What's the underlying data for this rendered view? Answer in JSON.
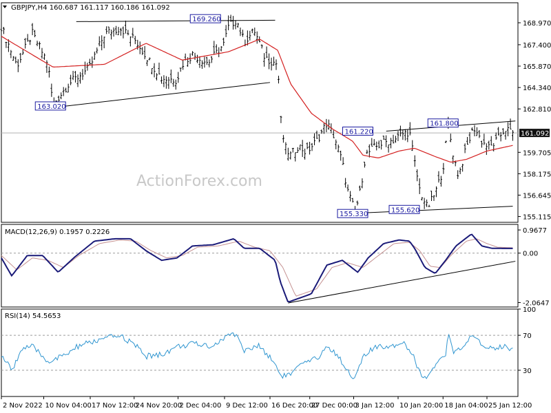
{
  "chart_data": [
    {
      "type": "candlestick",
      "symbol": "GBPJPY",
      "timeframe": "H4",
      "header": "GBPJPY,H4  160.687 161.117 160.186 161.092",
      "ohlc": {
        "open": 160.687,
        "high": 161.117,
        "low": 160.186,
        "close": 161.092
      },
      "last_price": "161.092",
      "ylim": [
        154.7,
        170.4
      ],
      "y_ticks": [
        "168.970",
        "167.400",
        "165.870",
        "164.340",
        "162.810",
        "161.092",
        "159.705",
        "158.175",
        "156.645",
        "155.115"
      ],
      "y_tick_values": [
        168.97,
        167.4,
        165.87,
        164.34,
        162.81,
        161.092,
        159.705,
        158.175,
        156.645,
        155.115
      ],
      "x_ticks": [
        "2 Nov 2022",
        "10 Nov 04:00",
        "17 Nov 12:00",
        "24 Nov 20:00",
        "2 Dec 04:00",
        "9 Dec 12:00",
        "16 Dec 20:00",
        "27 Dec 00:00",
        "3 Jan 12:00",
        "10 Jan 20:00",
        "18 Jan 04:00",
        "25 Jan 12:00"
      ],
      "annotations": [
        {
          "text": "163.020",
          "value": 163.02,
          "at": 0.095
        },
        {
          "text": "169.260",
          "value": 169.26,
          "at": 0.395
        },
        {
          "text": "161.220",
          "value": 161.22,
          "at": 0.69
        },
        {
          "text": "161.800",
          "value": 161.8,
          "at": 0.855
        },
        {
          "text": "155.330",
          "value": 155.33,
          "at": 0.68
        },
        {
          "text": "155.620",
          "value": 155.62,
          "at": 0.78
        }
      ],
      "trendlines": [
        {
          "from": [
            0.145,
            169.05
          ],
          "to": [
            0.53,
            169.15
          ]
        },
        {
          "from": [
            0.11,
            162.95
          ],
          "to": [
            0.52,
            164.7
          ]
        },
        {
          "from": [
            0.685,
            155.35
          ],
          "to": [
            0.99,
            155.85
          ]
        },
        {
          "from": [
            0.745,
            161.22
          ],
          "to": [
            0.995,
            161.95
          ]
        }
      ],
      "series": [
        {
          "role": "price",
          "points": [
            [
              0,
              168.7
            ],
            [
              0.03,
              165.9
            ],
            [
              0.06,
              168.2
            ],
            [
              0.09,
              166.1
            ],
            [
              0.1,
              163.1
            ],
            [
              0.13,
              164.6
            ],
            [
              0.17,
              165.7
            ],
            [
              0.2,
              168.2
            ],
            [
              0.23,
              168.6
            ],
            [
              0.26,
              167.7
            ],
            [
              0.28,
              166.6
            ],
            [
              0.31,
              165.0
            ],
            [
              0.34,
              164.9
            ],
            [
              0.35,
              166.0
            ],
            [
              0.37,
              166.7
            ],
            [
              0.4,
              166.1
            ],
            [
              0.43,
              167.4
            ],
            [
              0.44,
              168.7
            ],
            [
              0.455,
              169.2
            ],
            [
              0.47,
              167.6
            ],
            [
              0.49,
              168.4
            ],
            [
              0.51,
              166.5
            ],
            [
              0.535,
              166.0
            ],
            [
              0.542,
              161.5
            ],
            [
              0.55,
              160.0
            ],
            [
              0.56,
              159.5
            ],
            [
              0.575,
              160.2
            ],
            [
              0.59,
              159.7
            ],
            [
              0.61,
              160.5
            ],
            [
              0.63,
              161.8
            ],
            [
              0.645,
              160.8
            ],
            [
              0.66,
              159.0
            ],
            [
              0.67,
              157.0
            ],
            [
              0.685,
              155.4
            ],
            [
              0.695,
              157.0
            ],
            [
              0.705,
              159.5
            ],
            [
              0.72,
              160.0
            ],
            [
              0.74,
              160.4
            ],
            [
              0.76,
              160.6
            ],
            [
              0.775,
              161.0
            ],
            [
              0.79,
              161.2
            ],
            [
              0.8,
              159.0
            ],
            [
              0.81,
              157.0
            ],
            [
              0.825,
              155.7
            ],
            [
              0.84,
              156.8
            ],
            [
              0.855,
              158.5
            ],
            [
              0.865,
              161.7
            ],
            [
              0.875,
              159.5
            ],
            [
              0.885,
              158.0
            ],
            [
              0.9,
              160.0
            ],
            [
              0.915,
              161.5
            ],
            [
              0.93,
              160.5
            ],
            [
              0.945,
              160.0
            ],
            [
              0.96,
              160.6
            ],
            [
              0.975,
              161.4
            ],
            [
              0.99,
              161.09
            ]
          ]
        },
        {
          "role": "ma",
          "points": [
            [
              0,
              168.0
            ],
            [
              0.1,
              165.8
            ],
            [
              0.2,
              166.0
            ],
            [
              0.28,
              167.5
            ],
            [
              0.35,
              166.3
            ],
            [
              0.44,
              166.9
            ],
            [
              0.5,
              167.8
            ],
            [
              0.535,
              167.0
            ],
            [
              0.56,
              164.6
            ],
            [
              0.6,
              162.5
            ],
            [
              0.64,
              161.4
            ],
            [
              0.68,
              160.5
            ],
            [
              0.7,
              159.5
            ],
            [
              0.73,
              159.3
            ],
            [
              0.77,
              159.8
            ],
            [
              0.8,
              160.0
            ],
            [
              0.84,
              159.4
            ],
            [
              0.87,
              159.0
            ],
            [
              0.9,
              159.2
            ],
            [
              0.94,
              159.8
            ],
            [
              0.99,
              160.2
            ]
          ]
        }
      ]
    },
    {
      "type": "line",
      "label": "MACD(12,26,9) 0.1957 0.2226",
      "ylim": [
        -2.25,
        1.2
      ],
      "y_ticks": [
        "0.9677",
        "0.00",
        "-2.0647"
      ],
      "y_tick_values": [
        0.9677,
        0,
        -2.0647
      ],
      "trendlines": [
        {
          "from": [
            0.555,
            -2.08
          ],
          "to": [
            0.995,
            -0.34
          ]
        }
      ],
      "series": [
        {
          "role": "macd",
          "points": [
            [
              0,
              -0.2
            ],
            [
              0.02,
              -0.95
            ],
            [
              0.05,
              -0.1
            ],
            [
              0.08,
              -0.1
            ],
            [
              0.11,
              -0.8
            ],
            [
              0.14,
              -0.2
            ],
            [
              0.18,
              0.5
            ],
            [
              0.22,
              0.6
            ],
            [
              0.25,
              0.6
            ],
            [
              0.28,
              0.1
            ],
            [
              0.31,
              -0.3
            ],
            [
              0.34,
              -0.2
            ],
            [
              0.37,
              0.3
            ],
            [
              0.41,
              0.35
            ],
            [
              0.45,
              0.6
            ],
            [
              0.47,
              0.2
            ],
            [
              0.5,
              0.2
            ],
            [
              0.53,
              -0.3
            ],
            [
              0.54,
              -1.2
            ],
            [
              0.555,
              -2.05
            ],
            [
              0.6,
              -1.7
            ],
            [
              0.63,
              -0.5
            ],
            [
              0.66,
              -0.3
            ],
            [
              0.69,
              -0.8
            ],
            [
              0.71,
              -0.2
            ],
            [
              0.74,
              0.4
            ],
            [
              0.77,
              0.55
            ],
            [
              0.79,
              0.5
            ],
            [
              0.8,
              0.2
            ],
            [
              0.82,
              -0.6
            ],
            [
              0.84,
              -0.85
            ],
            [
              0.86,
              -0.3
            ],
            [
              0.88,
              0.3
            ],
            [
              0.91,
              0.8
            ],
            [
              0.93,
              0.3
            ],
            [
              0.95,
              0.2
            ],
            [
              0.99,
              0.1957
            ]
          ]
        },
        {
          "role": "signal",
          "points": [
            [
              0,
              -0.1
            ],
            [
              0.03,
              -0.7
            ],
            [
              0.06,
              -0.2
            ],
            [
              0.09,
              -0.3
            ],
            [
              0.12,
              -0.6
            ],
            [
              0.15,
              -0.1
            ],
            [
              0.19,
              0.4
            ],
            [
              0.23,
              0.55
            ],
            [
              0.26,
              0.5
            ],
            [
              0.29,
              0.1
            ],
            [
              0.32,
              -0.2
            ],
            [
              0.35,
              -0.1
            ],
            [
              0.38,
              0.25
            ],
            [
              0.42,
              0.3
            ],
            [
              0.46,
              0.5
            ],
            [
              0.49,
              0.25
            ],
            [
              0.52,
              0.1
            ],
            [
              0.545,
              -0.6
            ],
            [
              0.57,
              -1.8
            ],
            [
              0.61,
              -1.5
            ],
            [
              0.64,
              -0.6
            ],
            [
              0.67,
              -0.4
            ],
            [
              0.7,
              -0.6
            ],
            [
              0.73,
              -0.1
            ],
            [
              0.76,
              0.4
            ],
            [
              0.79,
              0.45
            ],
            [
              0.81,
              0.1
            ],
            [
              0.83,
              -0.55
            ],
            [
              0.85,
              -0.6
            ],
            [
              0.87,
              -0.1
            ],
            [
              0.9,
              0.5
            ],
            [
              0.92,
              0.6
            ],
            [
              0.94,
              0.4
            ],
            [
              0.96,
              0.25
            ],
            [
              0.99,
              0.2226
            ]
          ]
        }
      ]
    },
    {
      "type": "line",
      "label": "RSI(14) 54.5653",
      "ylim": [
        0,
        100
      ],
      "y_ticks": [
        "100",
        "70",
        "30",
        "0"
      ],
      "y_tick_values": [
        100,
        70,
        30,
        0
      ],
      "series": [
        {
          "role": "rsi",
          "points": [
            [
              0,
              47
            ],
            [
              0.02,
              30
            ],
            [
              0.04,
              55
            ],
            [
              0.06,
              57
            ],
            [
              0.09,
              40
            ],
            [
              0.12,
              46
            ],
            [
              0.15,
              58
            ],
            [
              0.2,
              66
            ],
            [
              0.23,
              70
            ],
            [
              0.26,
              58
            ],
            [
              0.28,
              46
            ],
            [
              0.31,
              48
            ],
            [
              0.34,
              57
            ],
            [
              0.37,
              60
            ],
            [
              0.41,
              58
            ],
            [
              0.44,
              70
            ],
            [
              0.455,
              72
            ],
            [
              0.47,
              52
            ],
            [
              0.5,
              58
            ],
            [
              0.53,
              38
            ],
            [
              0.54,
              24
            ],
            [
              0.56,
              25
            ],
            [
              0.58,
              36
            ],
            [
              0.61,
              43
            ],
            [
              0.63,
              57
            ],
            [
              0.65,
              48
            ],
            [
              0.67,
              30
            ],
            [
              0.685,
              20
            ],
            [
              0.7,
              45
            ],
            [
              0.72,
              55
            ],
            [
              0.75,
              58
            ],
            [
              0.78,
              62
            ],
            [
              0.8,
              44
            ],
            [
              0.81,
              26
            ],
            [
              0.825,
              22
            ],
            [
              0.84,
              36
            ],
            [
              0.86,
              46
            ],
            [
              0.865,
              71
            ],
            [
              0.875,
              52
            ],
            [
              0.89,
              53
            ],
            [
              0.91,
              68
            ],
            [
              0.93,
              60
            ],
            [
              0.95,
              55
            ],
            [
              0.97,
              58
            ],
            [
              0.99,
              54.5653
            ]
          ]
        }
      ]
    }
  ],
  "watermark": "ActionForex.com",
  "colors": {
    "price": "#000000",
    "ma": "#d42020",
    "macd": "#1a1a78",
    "signal": "#c49090",
    "rsi": "#2f95d0",
    "dashed": "#9a9a9a",
    "annotation_fill": "#ffffff",
    "annotation_border": "#1a1aa0",
    "price_flag_bg": "#111111",
    "price_flag_text": "#ffffff"
  }
}
